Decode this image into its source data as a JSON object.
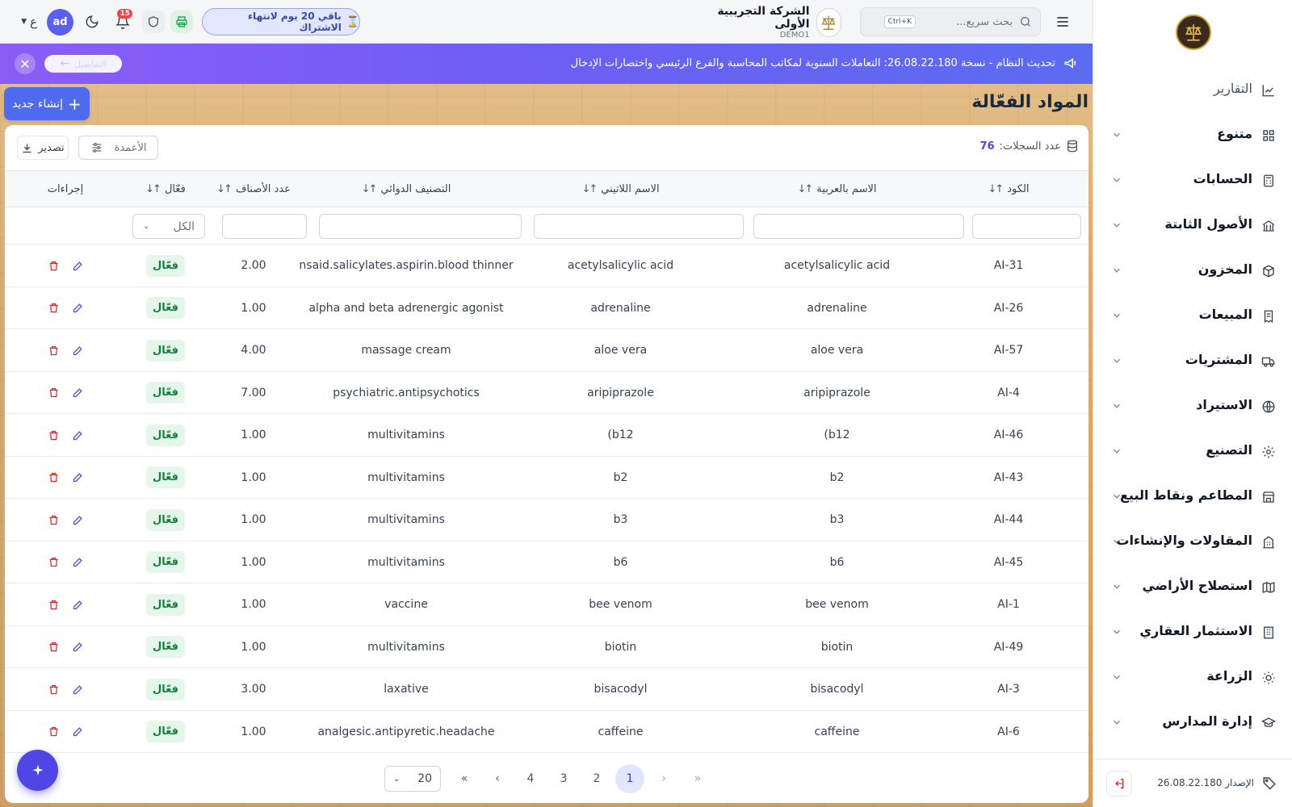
{
  "header": {
    "search_placeholder": "بحث سريع...",
    "shortcut": "Ctrl+K",
    "company_name": "الشركة التجريبية الأولى",
    "company_code": "DEMO1",
    "subscription_text": "باقي 20 يوم لانتهاء الاشتراك",
    "notifications_count": "15",
    "avatar_initials": "ad",
    "language": "ع"
  },
  "banner": {
    "text": "تحديث النظام - نسخة 26.08.22.180: التعاملات السنوية لمكاتب المحاسبة والفرع الرئيسي واختصارات الإدخال",
    "button_label": "التفاصيل"
  },
  "page": {
    "title": "المواد الفعّالة",
    "create_label": "إنشاء جديد"
  },
  "toolbar": {
    "records_label": "عدد السجلات:",
    "records_count": "76",
    "columns_label": "الأعمدة",
    "export_label": "تصدير"
  },
  "table": {
    "headers": {
      "code": "الكود",
      "arabic_name": "الاسم بالعربية",
      "latin_name": "الاسم اللاتيني",
      "classification": "التصنيف الدوائي",
      "items_count": "عدد الأصناف",
      "active": "فعّال",
      "actions": "إجراءات"
    },
    "status_filter": "الكل",
    "rows": [
      {
        "code": "AI-31",
        "arabic": "acetylsalicylic acid",
        "latin": "acetylsalicylic acid",
        "class": "nsaid.salicylates.aspirin.blood thinner",
        "count": "2.00",
        "status": "فعّال"
      },
      {
        "code": "AI-26",
        "arabic": "adrenaline",
        "latin": "adrenaline",
        "class": "alpha and beta adrenergic agonist",
        "count": "1.00",
        "status": "فعّال"
      },
      {
        "code": "AI-57",
        "arabic": "aloe vera",
        "latin": "aloe vera",
        "class": "massage cream",
        "count": "4.00",
        "status": "فعّال"
      },
      {
        "code": "AI-4",
        "arabic": "aripiprazole",
        "latin": "aripiprazole",
        "class": "psychiatric.antipsychotics",
        "count": "7.00",
        "status": "فعّال"
      },
      {
        "code": "AI-46",
        "arabic": "(b12",
        "latin": "(b12",
        "class": "multivitamins",
        "count": "1.00",
        "status": "فعّال"
      },
      {
        "code": "AI-43",
        "arabic": "b2",
        "latin": "b2",
        "class": "multivitamins",
        "count": "1.00",
        "status": "فعّال"
      },
      {
        "code": "AI-44",
        "arabic": "b3",
        "latin": "b3",
        "class": "multivitamins",
        "count": "1.00",
        "status": "فعّال"
      },
      {
        "code": "AI-45",
        "arabic": "b6",
        "latin": "b6",
        "class": "multivitamins",
        "count": "1.00",
        "status": "فعّال"
      },
      {
        "code": "AI-1",
        "arabic": "bee venom",
        "latin": "bee venom",
        "class": "vaccine",
        "count": "1.00",
        "status": "فعّال"
      },
      {
        "code": "AI-49",
        "arabic": "biotin",
        "latin": "biotin",
        "class": "multivitamins",
        "count": "1.00",
        "status": "فعّال"
      },
      {
        "code": "AI-3",
        "arabic": "bisacodyl",
        "latin": "bisacodyl",
        "class": "laxative",
        "count": "3.00",
        "status": "فعّال"
      },
      {
        "code": "AI-6",
        "arabic": "caffeine",
        "latin": "caffeine",
        "class": "analgesic.antipyretic.headache",
        "count": "1.00",
        "status": "فعّال"
      }
    ]
  },
  "pagination": {
    "pages": [
      "1",
      "2",
      "3",
      "4"
    ],
    "current": "1",
    "page_size": "20"
  },
  "sidebar": {
    "items": [
      {
        "label": "التقارير",
        "icon": "chart-line-icon",
        "bold": false,
        "chevron": false
      },
      {
        "label": "متنوع",
        "icon": "grid-icon",
        "bold": true,
        "chevron": true
      },
      {
        "label": "الحسابات",
        "icon": "calculator-icon",
        "bold": true,
        "chevron": true
      },
      {
        "label": "الأصول الثابتة",
        "icon": "building-bank-icon",
        "bold": true,
        "chevron": true
      },
      {
        "label": "المخزون",
        "icon": "box-icon",
        "bold": true,
        "chevron": true
      },
      {
        "label": "المبيعات",
        "icon": "receipt-icon",
        "bold": true,
        "chevron": true
      },
      {
        "label": "المشتريات",
        "icon": "truck-icon",
        "bold": true,
        "chevron": true
      },
      {
        "label": "الاستيراد",
        "icon": "globe-icon",
        "bold": true,
        "chevron": true
      },
      {
        "label": "التصنيع",
        "icon": "gear-icon",
        "bold": true,
        "chevron": true
      },
      {
        "label": "المطاعم ونقاط البيع",
        "icon": "store-icon",
        "bold": true,
        "chevron": true
      },
      {
        "label": "المقاولات والإنشاءات",
        "icon": "building-icon",
        "bold": true,
        "chevron": true
      },
      {
        "label": "استصلاح الأراضي",
        "icon": "map-icon",
        "bold": true,
        "chevron": true
      },
      {
        "label": "الاستثمار العقاري",
        "icon": "office-icon",
        "bold": true,
        "chevron": true
      },
      {
        "label": "الزراعة",
        "icon": "sun-icon",
        "bold": true,
        "chevron": true
      },
      {
        "label": "إدارة المدارس",
        "icon": "graduation-cap-icon",
        "bold": true,
        "chevron": true
      }
    ],
    "version_label": "الإصدار 26.08.22.180"
  },
  "colors": {
    "primary": "#4f6bed",
    "badge_bg": "#e5f6ea",
    "badge_text": "#15803d",
    "danger": "#dc2626",
    "banner_start": "#8b5cf6",
    "banner_end": "#5b6cf0"
  }
}
